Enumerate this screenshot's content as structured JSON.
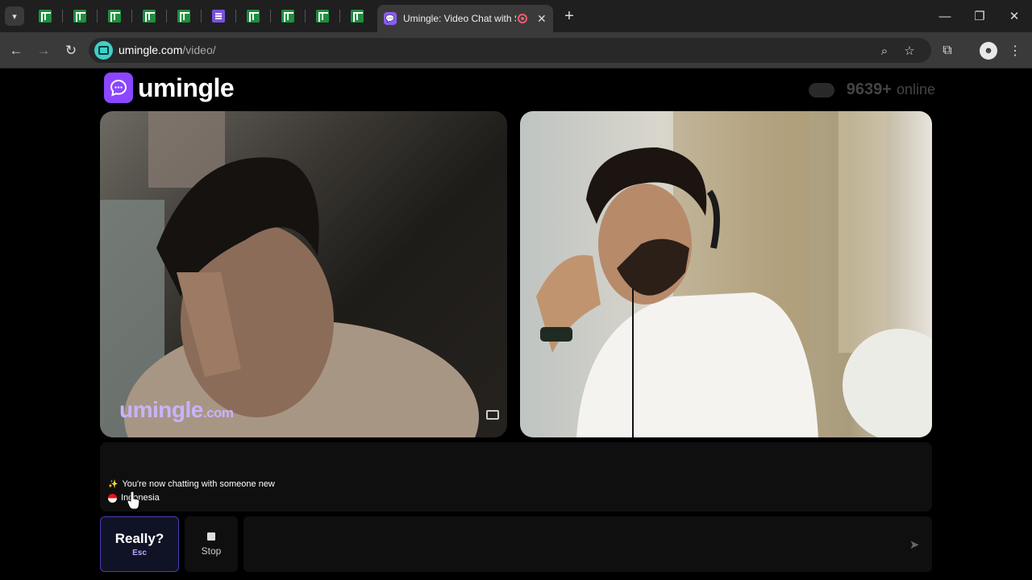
{
  "browser": {
    "tab_title": "Umingle: Video Chat with Strangers",
    "background_tabs": [
      "sheets",
      "sheets",
      "sheets",
      "sheets",
      "sheets",
      "forms",
      "sheets",
      "sheets",
      "sheets",
      "sheets"
    ],
    "url_host": "umingle.com",
    "url_path": "/video/"
  },
  "header": {
    "logo_text": "umingle",
    "online_count": "9639+",
    "online_label": "online"
  },
  "videos": {
    "watermark_main": "umingle",
    "watermark_domain": ".com"
  },
  "chat": {
    "messages": [
      {
        "icon": "sparkles-icon",
        "text": "You're now chatting with someone new"
      },
      {
        "icon": "indonesia-flag-icon",
        "text": "Indonesia"
      }
    ]
  },
  "controls": {
    "really_label": "Really?",
    "really_key": "Esc",
    "stop_label": "Stop",
    "message_placeholder": ""
  },
  "colors": {
    "brand": "#8b46ff",
    "accent_border": "#4a3fb8"
  }
}
